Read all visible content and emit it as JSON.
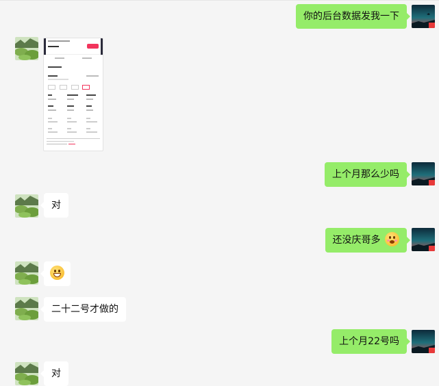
{
  "colors": {
    "background": "#f5f5f5",
    "outgoing_bubble": "#95ec69",
    "incoming_bubble": "#ffffff"
  },
  "messages": [
    {
      "side": "out",
      "text": "你的后台数据发我一下"
    },
    {
      "side": "in",
      "type": "image",
      "icon": "screenshot-thumbnail"
    },
    {
      "side": "out",
      "text": "上个月那么少吗"
    },
    {
      "side": "in",
      "text": "对"
    },
    {
      "side": "out",
      "text": "还没庆哥多",
      "emoji": "dizzy-face-emoji"
    },
    {
      "side": "in",
      "type": "emoji",
      "emoji": "grinning-face-emoji"
    },
    {
      "side": "in",
      "text": "二十二号才做的"
    },
    {
      "side": "out",
      "text": "上个月22号吗"
    },
    {
      "side": "in",
      "text": "对"
    }
  ]
}
